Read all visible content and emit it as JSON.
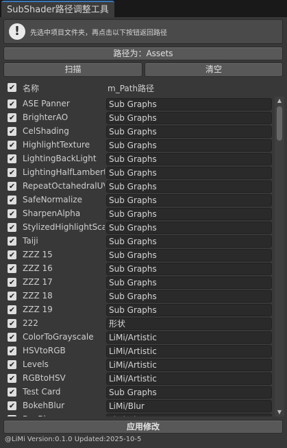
{
  "window": {
    "tab_title": "SubShader路径调整工具"
  },
  "help": {
    "icon": "info-icon",
    "text": "先选中项目文件夹，再点击以下按钮返回路径"
  },
  "buttons": {
    "path_label": "路径为：Assets",
    "scan_label": "扫描",
    "clear_label": "清空",
    "apply_label": "应用修改"
  },
  "header": {
    "checked": true,
    "name_label": "名称",
    "path_label": "m_Path路径"
  },
  "rows": [
    {
      "name": "ASE Panner",
      "path": "Sub Graphs",
      "checked": true
    },
    {
      "name": "BrighterAO",
      "path": "Sub Graphs",
      "checked": true
    },
    {
      "name": "CelShading",
      "path": "Sub Graphs",
      "checked": true
    },
    {
      "name": "HighlightTexture",
      "path": "Sub Graphs",
      "checked": true
    },
    {
      "name": "LightingBackLight",
      "path": "Sub Graphs",
      "checked": true
    },
    {
      "name": "LightingHalfLambert",
      "path": "Sub Graphs",
      "checked": true
    },
    {
      "name": "RepeatOctahedralUV",
      "path": "Sub Graphs",
      "checked": true
    },
    {
      "name": "SafeNormalize",
      "path": "Sub Graphs",
      "checked": true
    },
    {
      "name": "SharpenAlpha",
      "path": "Sub Graphs",
      "checked": true
    },
    {
      "name": "StylizedHighlightScale",
      "path": "Sub Graphs",
      "checked": true
    },
    {
      "name": "Taiji",
      "path": "Sub Graphs",
      "checked": true
    },
    {
      "name": "ZZZ 15",
      "path": "Sub Graphs",
      "checked": true
    },
    {
      "name": "ZZZ 16",
      "path": "Sub Graphs",
      "checked": true
    },
    {
      "name": "ZZZ 17",
      "path": "Sub Graphs",
      "checked": true
    },
    {
      "name": "ZZZ 18",
      "path": "Sub Graphs",
      "checked": true
    },
    {
      "name": "ZZZ 19",
      "path": "Sub Graphs",
      "checked": true
    },
    {
      "name": "222",
      "path": "形状",
      "checked": true
    },
    {
      "name": "ColorToGrayscale",
      "path": "LiMi/Artistic",
      "checked": true
    },
    {
      "name": "HSVtoRGB",
      "path": "LiMi/Artistic",
      "checked": true
    },
    {
      "name": "Levels",
      "path": "LiMi/Artistic",
      "checked": true
    },
    {
      "name": "RGBtoHSV",
      "path": "LiMi/Artistic",
      "checked": true
    },
    {
      "name": "Test Card",
      "path": "Sub Graphs",
      "checked": true
    },
    {
      "name": "BokehBlur",
      "path": "LiMi/Blur",
      "checked": true
    },
    {
      "name": "BoxBlur",
      "path": "LiMi/Blur",
      "checked": true
    }
  ],
  "footer": {
    "text": "@LiMi  Version:0.1.0  Updated:2025-10-5"
  },
  "colors": {
    "accent": "#3a79bb",
    "panel": "#383838",
    "field": "#2a2a2a"
  }
}
